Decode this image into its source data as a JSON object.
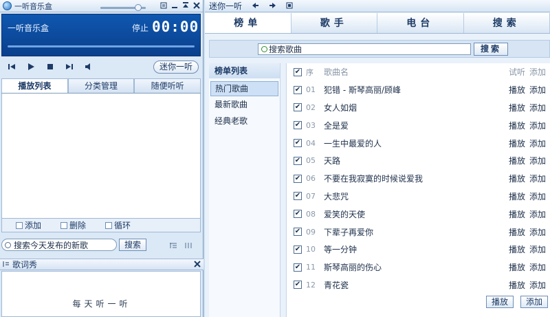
{
  "player": {
    "title": "一听音乐盒",
    "display_name": "一听音乐盒",
    "state": "停止",
    "time": "00:00",
    "mini_label": "迷你一听",
    "tabs": [
      "播放列表",
      "分类管理",
      "随便听听"
    ],
    "actions": {
      "add": "添加",
      "delete": "删除",
      "loop": "循环"
    },
    "search_value": "搜索今天发布的新歌",
    "search_button": "搜索",
    "lyric_title": "歌词秀",
    "lyric_text": "每天听一听"
  },
  "browser": {
    "title": "迷你一听",
    "tabs": [
      "榜单",
      "歌手",
      "电台",
      "搜索"
    ],
    "search_placeholder": "搜索歌曲",
    "search_button": "搜索",
    "rank_header": "榜单列表",
    "rank_items": [
      "热门歌曲",
      "最新歌曲",
      "经典老歌"
    ],
    "columns": {
      "idx": "序",
      "name": "歌曲名",
      "listen": "试听",
      "add": "添加"
    },
    "songs": [
      {
        "idx": "01",
        "title": "犯错 - 斯琴高丽/顾峰"
      },
      {
        "idx": "02",
        "title": "女人如烟"
      },
      {
        "idx": "03",
        "title": "全是爱"
      },
      {
        "idx": "04",
        "title": "一生中最爱的人"
      },
      {
        "idx": "05",
        "title": "天路"
      },
      {
        "idx": "06",
        "title": "不要在我寂寞的时候说爱我"
      },
      {
        "idx": "07",
        "title": "大悲咒"
      },
      {
        "idx": "08",
        "title": "爱笑的天使"
      },
      {
        "idx": "09",
        "title": "下辈子再爱你"
      },
      {
        "idx": "10",
        "title": "等一分钟"
      },
      {
        "idx": "11",
        "title": "斯琴高丽的伤心"
      },
      {
        "idx": "12",
        "title": "青花瓷"
      }
    ],
    "row_play": "播放",
    "row_add": "添加",
    "footer_play": "播放",
    "footer_add": "添加"
  }
}
